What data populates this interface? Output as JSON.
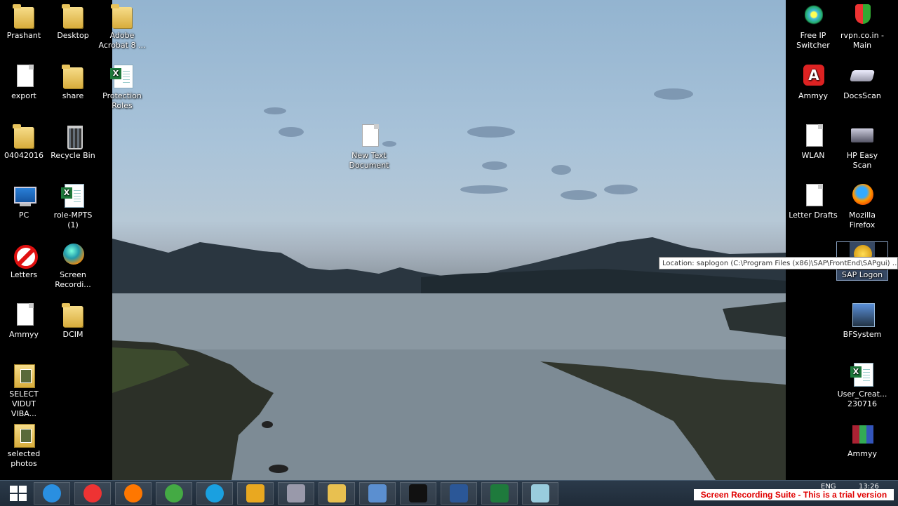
{
  "desktop": {
    "left_icons": [
      {
        "name": "prashant-folder-icon",
        "label": "Prashant",
        "glyph": "folder"
      },
      {
        "name": "desktop-folder-icon",
        "label": "Desktop",
        "glyph": "folder"
      },
      {
        "name": "adobe-acrobat-folder-icon",
        "label": "Adobe Acrobat 8 ...",
        "glyph": "folder"
      },
      {
        "name": "export-file-icon",
        "label": "export",
        "glyph": "doc"
      },
      {
        "name": "share-folder-icon",
        "label": "share",
        "glyph": "folder"
      },
      {
        "name": "protection-roles-excel-icon",
        "label": "Protection Roles",
        "glyph": "xls"
      },
      {
        "name": "folder-04042016-icon",
        "label": "04042016",
        "glyph": "folder"
      },
      {
        "name": "recycle-bin-icon",
        "label": "Recycle Bin",
        "glyph": "bin"
      },
      {
        "name": "pc-icon",
        "label": "PC",
        "glyph": "pc"
      },
      {
        "name": "role-mpts-excel-icon",
        "label": "role-MPTS (1)",
        "glyph": "xls"
      },
      {
        "name": "letters-icon",
        "label": "Letters",
        "glyph": "noentry"
      },
      {
        "name": "screen-recording-icon",
        "label": "Screen Recordi...",
        "glyph": "globe"
      },
      {
        "name": "ammyy-file-icon",
        "label": "Ammyy",
        "glyph": "doc"
      },
      {
        "name": "dcim-folder-icon",
        "label": "DCIM",
        "glyph": "folder"
      },
      {
        "name": "select-vidut-folder-icon",
        "label": "SELECT VIDUT VIBA...",
        "glyph": "photofolder"
      },
      {
        "name": "selected-photos-folder-icon",
        "label": "selected photos",
        "glyph": "photofolder"
      }
    ],
    "center_icon": {
      "name": "new-text-document-icon",
      "label": "New Text Document",
      "glyph": "doc"
    },
    "right_icons": [
      {
        "name": "free-ip-switcher-icon",
        "label": "Free IP Switcher",
        "glyph": "flower"
      },
      {
        "name": "rvpn-icon",
        "label": "rvpn.co.in - Main",
        "glyph": "shield"
      },
      {
        "name": "ammyy-app-icon",
        "label": "Ammyy",
        "glyph": "ammyy"
      },
      {
        "name": "docsscan-icon",
        "label": "DocsScan",
        "glyph": "scanner"
      },
      {
        "name": "wlan-file-icon",
        "label": "WLAN",
        "glyph": "doc"
      },
      {
        "name": "hp-easy-scan-icon",
        "label": "HP Easy Scan",
        "glyph": "hpscan"
      },
      {
        "name": "letter-drafts-file-icon",
        "label": "Letter Drafts",
        "glyph": "doc"
      },
      {
        "name": "mozilla-firefox-icon",
        "label": "Mozilla Firefox",
        "glyph": "firefox"
      },
      {
        "name": "sap-logon-icon",
        "label": "SAP Logon",
        "glyph": "sap",
        "selected": true
      },
      {
        "name": "bfsystem-icon",
        "label": "BFSystem",
        "glyph": "bfs"
      },
      {
        "name": "user-create-excel-icon",
        "label": "User_Creat... 230716",
        "glyph": "xls"
      },
      {
        "name": "ammyy-winrar-icon",
        "label": "Ammyy",
        "glyph": "winrar"
      }
    ],
    "tooltip": "Location: saplogon (C:\\Program Files (x86)\\SAP\\FrontEnd\\SAPgui) …"
  },
  "taskbar": {
    "buttons": [
      {
        "name": "start-button-icon",
        "kind": "start"
      },
      {
        "name": "internet-explorer-icon",
        "color": "#2a8fe0"
      },
      {
        "name": "chrome-icon",
        "color": "#e33"
      },
      {
        "name": "firefox-taskbar-icon",
        "color": "#f70"
      },
      {
        "name": "utorrent-icon",
        "color": "#4a4"
      },
      {
        "name": "skype-icon",
        "color": "#1aa0e0"
      },
      {
        "name": "sap-taskbar-icon",
        "color": "#e9a820"
      },
      {
        "name": "scanner-taskbar-icon",
        "color": "#99a"
      },
      {
        "name": "file-explorer-icon",
        "color": "#e8c050"
      },
      {
        "name": "control-panel-icon",
        "color": "#5b8fd0"
      },
      {
        "name": "command-prompt-icon",
        "color": "#111"
      },
      {
        "name": "word-icon",
        "color": "#2b5797"
      },
      {
        "name": "excel-icon",
        "color": "#1e7a3c"
      },
      {
        "name": "window-app-icon",
        "color": "#9cd"
      }
    ],
    "language": "ENG",
    "time": "13:26",
    "trial_banner": "Screen Recording Suite - This is a trial version"
  }
}
